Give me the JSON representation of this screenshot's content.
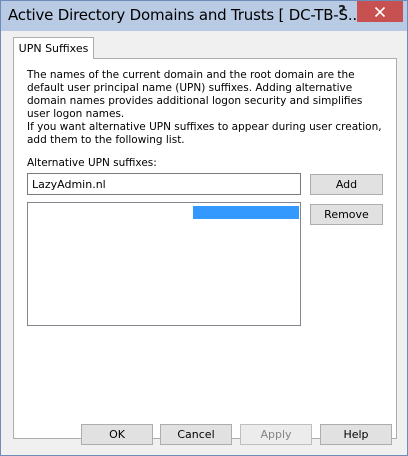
{
  "window": {
    "title": "Active Directory Domains and Trusts [ DC-TB-S...",
    "help_glyph": "?",
    "close_glyph": "✕"
  },
  "tab": {
    "label": "UPN Suffixes"
  },
  "content": {
    "description_1": "The names of the current domain and the root domain are the default user principal name (UPN) suffixes. Adding alternative domain names provides additional logon security and simplifies user logon names.",
    "description_2": "If you want alternative UPN suffixes to appear during user creation, add them to the following list.",
    "alt_label": "Alternative UPN suffixes:",
    "input_value": "LazyAdmin.nl",
    "add_label": "Add",
    "remove_label": "Remove"
  },
  "footer": {
    "ok_label": "OK",
    "cancel_label": "Cancel",
    "apply_label": "Apply",
    "help_label": "Help"
  },
  "colors": {
    "titlebar": "#b9cbe4",
    "close_button": "#c75050",
    "selection": "#3399ff"
  }
}
